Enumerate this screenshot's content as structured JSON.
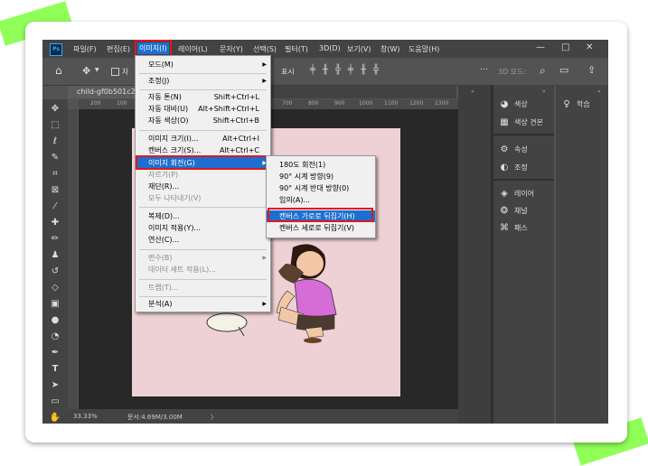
{
  "menubar": {
    "items": [
      "파일(F)",
      "편집(E)",
      "이미지(I)",
      "레이어(L)",
      "문자(Y)",
      "선택(S)",
      "필터(T)",
      "3D(D)",
      "보기(V)",
      "창(W)",
      "도움말(H)"
    ]
  },
  "app": {
    "logo": "Ps",
    "window_controls": [
      "—",
      "□",
      "✕"
    ]
  },
  "optionsbar": {
    "checkbox_label": "자",
    "show_label": "표시",
    "mode_label": "3D 모드:"
  },
  "tab": {
    "title": "child-gf0b501c2"
  },
  "ruler": {
    "ticks": [
      "200",
      "100",
      "700",
      "800",
      "900",
      "1000",
      "1100",
      "1200",
      "1300"
    ]
  },
  "statusbar": {
    "zoom": "33.33%",
    "doc_info": "문서:4.69M/3.00M",
    "arrow": "〉"
  },
  "image_menu": {
    "items": [
      {
        "label": "모드(M)",
        "shortcut": "",
        "submenu": true,
        "disabled": false
      },
      {
        "label": "조정(J)",
        "shortcut": "",
        "submenu": true,
        "disabled": false
      },
      {
        "label": "자동 톤(N)",
        "shortcut": "Shift+Ctrl+L",
        "submenu": false,
        "disabled": false
      },
      {
        "label": "자동 대비(U)",
        "shortcut": "Alt+Shift+Ctrl+L",
        "submenu": false,
        "disabled": false
      },
      {
        "label": "자동 색상(O)",
        "shortcut": "Shift+Ctrl+B",
        "submenu": false,
        "disabled": false
      },
      {
        "label": "이미지 크기(I)...",
        "shortcut": "Alt+Ctrl+I",
        "submenu": false,
        "disabled": false
      },
      {
        "label": "캔버스 크기(S)...",
        "shortcut": "Alt+Ctrl+C",
        "submenu": false,
        "disabled": false
      },
      {
        "label": "이미지 회전(G)",
        "shortcut": "",
        "submenu": true,
        "disabled": false
      },
      {
        "label": "자르기(P)",
        "shortcut": "",
        "submenu": false,
        "disabled": true
      },
      {
        "label": "재단(R)...",
        "shortcut": "",
        "submenu": false,
        "disabled": false
      },
      {
        "label": "모두 나타내기(V)",
        "shortcut": "",
        "submenu": false,
        "disabled": true
      },
      {
        "label": "복제(D)...",
        "shortcut": "",
        "submenu": false,
        "disabled": false
      },
      {
        "label": "이미지 적용(Y)...",
        "shortcut": "",
        "submenu": false,
        "disabled": false
      },
      {
        "label": "연산(C)...",
        "shortcut": "",
        "submenu": false,
        "disabled": false
      },
      {
        "label": "변수(B)",
        "shortcut": "",
        "submenu": true,
        "disabled": true
      },
      {
        "label": "데이터 세트 적용(L)...",
        "shortcut": "",
        "submenu": false,
        "disabled": true
      },
      {
        "label": "트랩(T)...",
        "shortcut": "",
        "submenu": false,
        "disabled": true
      },
      {
        "label": "분석(A)",
        "shortcut": "",
        "submenu": true,
        "disabled": false
      }
    ]
  },
  "rotate_submenu": {
    "items": [
      {
        "label": "180도 회전(1)"
      },
      {
        "label": "90° 시계 방향(9)"
      },
      {
        "label": "90° 시계 반대 방향(0)"
      },
      {
        "label": "임의(A)..."
      },
      {
        "label": "캔버스 가로로 뒤집기(H)"
      },
      {
        "label": "캔버스 세로로 뒤집기(V)"
      }
    ]
  },
  "panels": {
    "group1": [
      "색상",
      "색상 견본"
    ],
    "group2": [
      "속성",
      "조정"
    ],
    "group3": [
      "레이어",
      "채널",
      "패스"
    ],
    "right": [
      "학습"
    ]
  },
  "colors": {
    "highlight": "#1c6fd0",
    "annotation": "#e2161c",
    "canvas_bg": "#eed1d5",
    "tape": "#7dff3a"
  }
}
